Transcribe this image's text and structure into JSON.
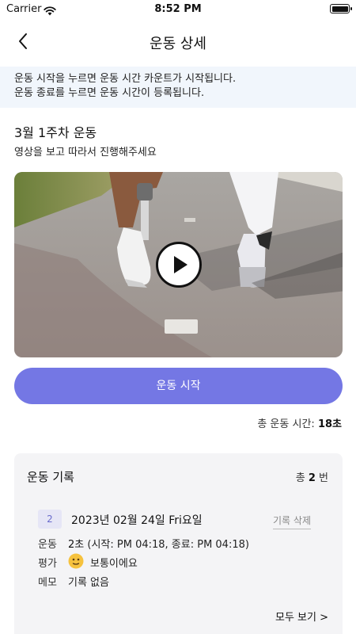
{
  "status_bar": {
    "carrier": "Carrier",
    "time": "8:52 PM"
  },
  "nav": {
    "title": "운동 상세"
  },
  "notice": {
    "line1": "운동 시작을 누르면 운동 시간 카운트가 시작됩니다.",
    "line2": "운동 종료를 누르면 운동 시간이 등록됩니다."
  },
  "exercise": {
    "title": "3월 1주차 운동",
    "subtitle": "영상을 보고 따라서 진행해주세요"
  },
  "start_button": {
    "label": "운동 시작"
  },
  "total_time": {
    "label": "총 운동 시간:",
    "value": "18초"
  },
  "records": {
    "title": "운동 기록",
    "count_prefix": "총",
    "count": "2",
    "count_suffix": "번",
    "entry": {
      "number": "2",
      "date": "2023년 02월 24일 Fri요일",
      "delete_label": "기록 삭제",
      "exercise_label": "운동",
      "exercise_duration": "2초",
      "exercise_detail": "(시작: PM 04:18, 종료: PM 04:18)",
      "rating_label": "평가",
      "rating_value": "보통이에요",
      "memo_label": "메모",
      "memo_value": "기록 없음"
    },
    "view_all": "모두 보기 >"
  },
  "colors": {
    "accent": "#7477e4",
    "notice_bg": "#f1f6fc",
    "card_bg": "#f4f4f6"
  }
}
